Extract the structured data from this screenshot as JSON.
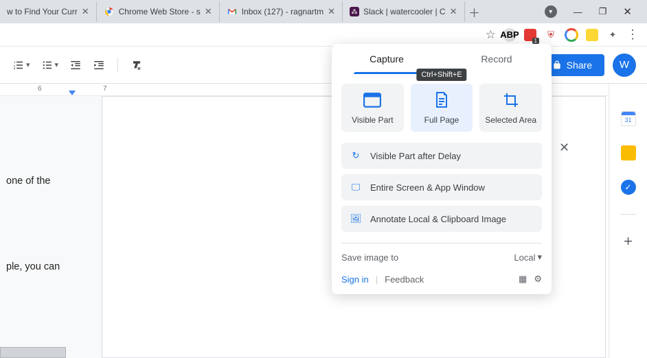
{
  "tabs": [
    {
      "title": "w to Find Your Curr",
      "favicon": ""
    },
    {
      "title": "Chrome Web Store  -  s",
      "favicon": "🔴"
    },
    {
      "title": "Inbox (127) - ragnartm",
      "favicon": "M"
    },
    {
      "title": "Slack | watercooler | C",
      "favicon": "❖"
    }
  ],
  "ext_icons": {
    "abp": "ABP",
    "badge": "1"
  },
  "docs": {
    "numlist": "",
    "bullist": "",
    "share": "Share",
    "avatar": "W",
    "line1": "one of the",
    "line2": "ple, you can",
    "ruler": {
      "m6": "6",
      "m7": "7"
    }
  },
  "side": {
    "cal": "31",
    "plus": "+"
  },
  "popup": {
    "tab_capture": "Capture",
    "tab_record": "Record",
    "tooltip": "Ctrl+Shift+E",
    "opt_visible": "Visible Part",
    "opt_full": "Full Page",
    "opt_selected": "Selected Area",
    "row_delay": "Visible Part after Delay",
    "row_screen": "Entire Screen & App Window",
    "row_annotate": "Annotate Local & Clipboard Image",
    "save_label": "Save image to",
    "save_value": "Local",
    "signin": "Sign in",
    "feedback": "Feedback"
  }
}
